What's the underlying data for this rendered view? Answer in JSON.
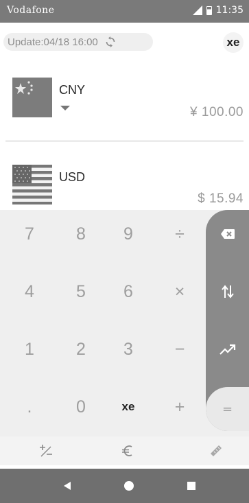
{
  "status_bar": {
    "carrier": "Vodafone",
    "time": "11:35"
  },
  "header": {
    "update_label": "Update:04/18 16:00",
    "logo": "xe"
  },
  "currencies": [
    {
      "code": "CNY",
      "flag": "china-flag",
      "amount": "¥  100.00"
    },
    {
      "code": "USD",
      "flag": "usa-flag",
      "amount": "$  15.94"
    }
  ],
  "keypad": {
    "rows": [
      [
        "7",
        "8",
        "9",
        "÷"
      ],
      [
        "4",
        "5",
        "6",
        "×"
      ],
      [
        "1",
        "2",
        "3",
        "−"
      ],
      [
        ".",
        "0",
        "xe",
        "+"
      ]
    ],
    "side": [
      "backspace-icon",
      "swap-icon",
      "chart-icon",
      "="
    ]
  },
  "tools": [
    "plus-minus-icon",
    "euro-icon",
    "ruler-icon"
  ],
  "colors": {
    "statusbar": "#7a7a7a",
    "keypad_bg": "#efefef",
    "side_column": "#8a8a8a",
    "navbar": "#6f6f6f"
  }
}
